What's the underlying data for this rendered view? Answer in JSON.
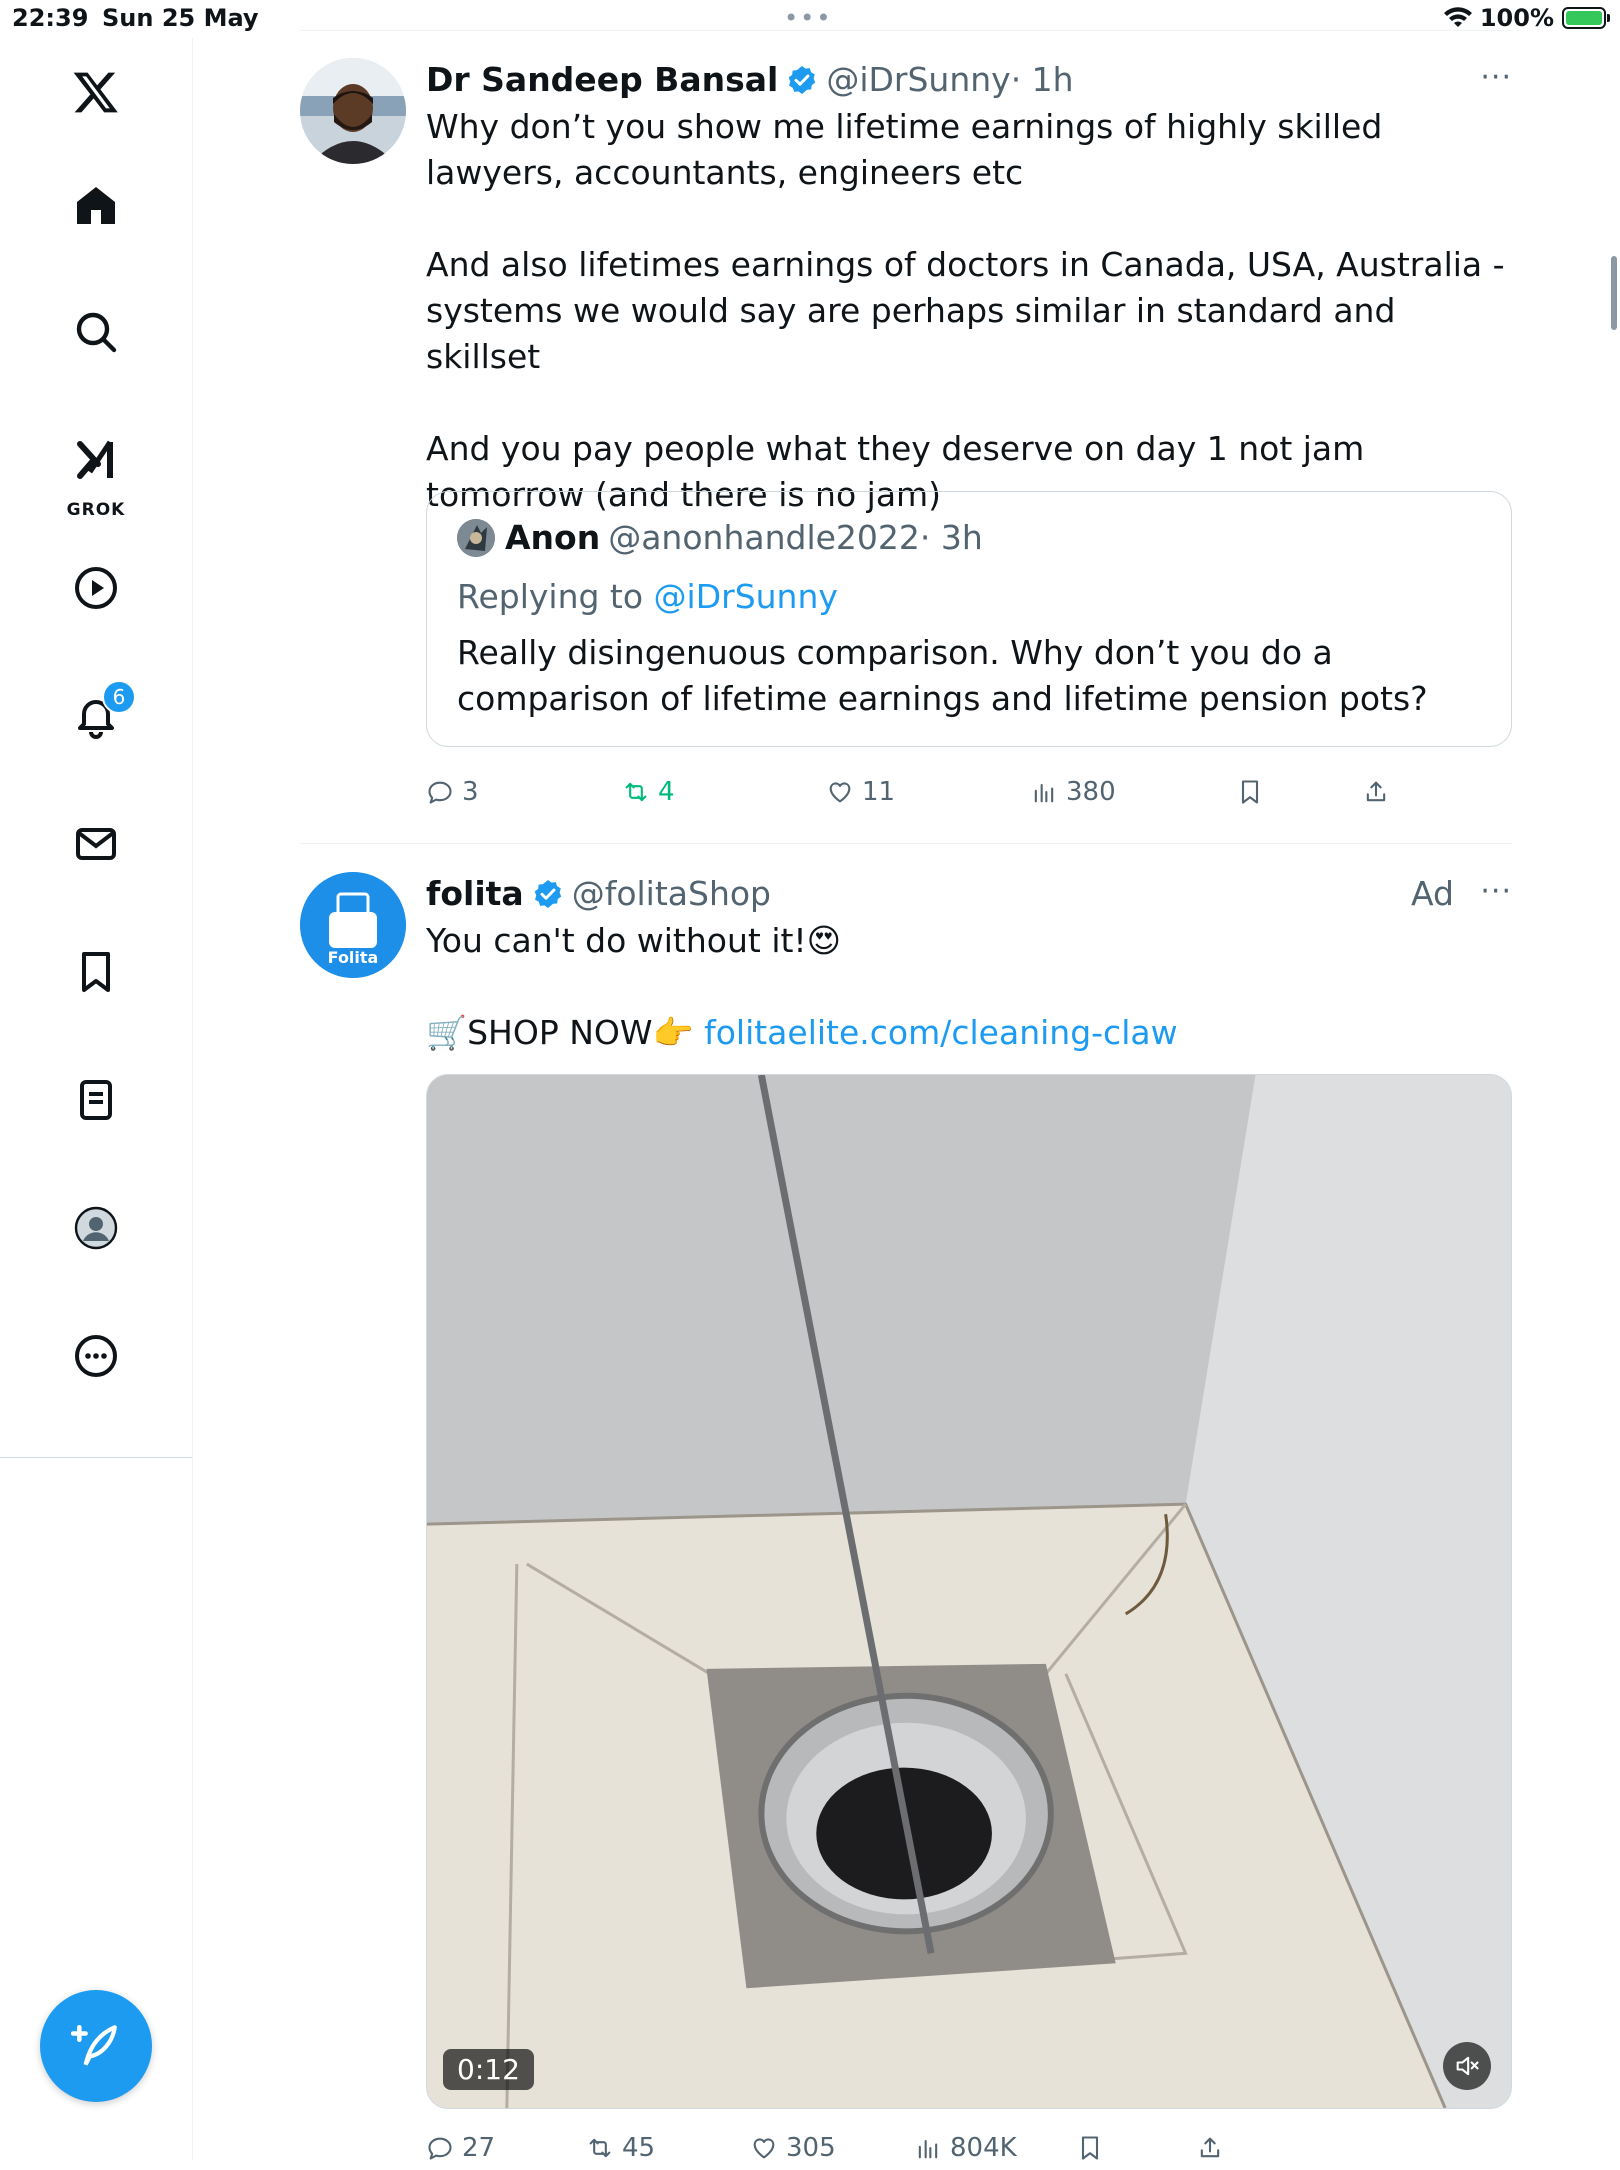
{
  "status_bar": {
    "time": "22:39",
    "date": "Sun 25 May",
    "battery": "100%"
  },
  "sidebar": {
    "items": [
      {
        "icon": "x-logo-icon"
      },
      {
        "icon": "home-icon"
      },
      {
        "icon": "search-icon"
      },
      {
        "icon": "grok-icon",
        "label": "GROK"
      },
      {
        "icon": "video-icon"
      },
      {
        "icon": "notifications-icon",
        "badge": "6"
      },
      {
        "icon": "messages-icon"
      },
      {
        "icon": "bookmarks-icon"
      },
      {
        "icon": "lists-icon"
      },
      {
        "icon": "profile-icon"
      },
      {
        "icon": "more-icon"
      }
    ],
    "compose_icon": "compose-icon"
  },
  "tweets": [
    {
      "name": "Dr Sandeep Bansal",
      "handle": "@iDrSunny",
      "time": "· 1h",
      "more": "···",
      "text": [
        "Why don’t you show me lifetime earnings of highly skilled lawyers, accountants, engineers etc",
        "And also lifetimes earnings of doctors in Canada, USA, Australia - systems we would say are perhaps similar in standard and skillset",
        "And you pay people what they deserve on day 1 not jam tomorrow (and there is no jam)"
      ],
      "quote": {
        "name": "Anon",
        "handle": "@anonhandle2022",
        "time": "· 3h",
        "replying_prefix": "Replying to",
        "replying_handle": "@iDrSunny",
        "text": "Really disingenuous comparison. Why don’t you do a comparison of lifetime earnings and lifetime pension pots?"
      },
      "actions": {
        "replies": "3",
        "reposts": "4",
        "likes": "11",
        "views": "380"
      }
    },
    {
      "name": "folita",
      "handle": "@folitaShop",
      "avatar_label": "Folita",
      "ad": "Ad",
      "more": "···",
      "text_line1": "You can't do without it!😍",
      "shop_text": "🛒SHOP NOW👉",
      "link": "folitaelite.com/cleaning-claw",
      "video_duration": "0:12",
      "actions": {
        "replies": "27",
        "reposts": "45",
        "likes": "305",
        "views": "804K"
      }
    }
  ],
  "colors": {
    "accent": "#1d9bf0",
    "repost_green": "#00ba7c",
    "secondary_text": "#536471"
  }
}
